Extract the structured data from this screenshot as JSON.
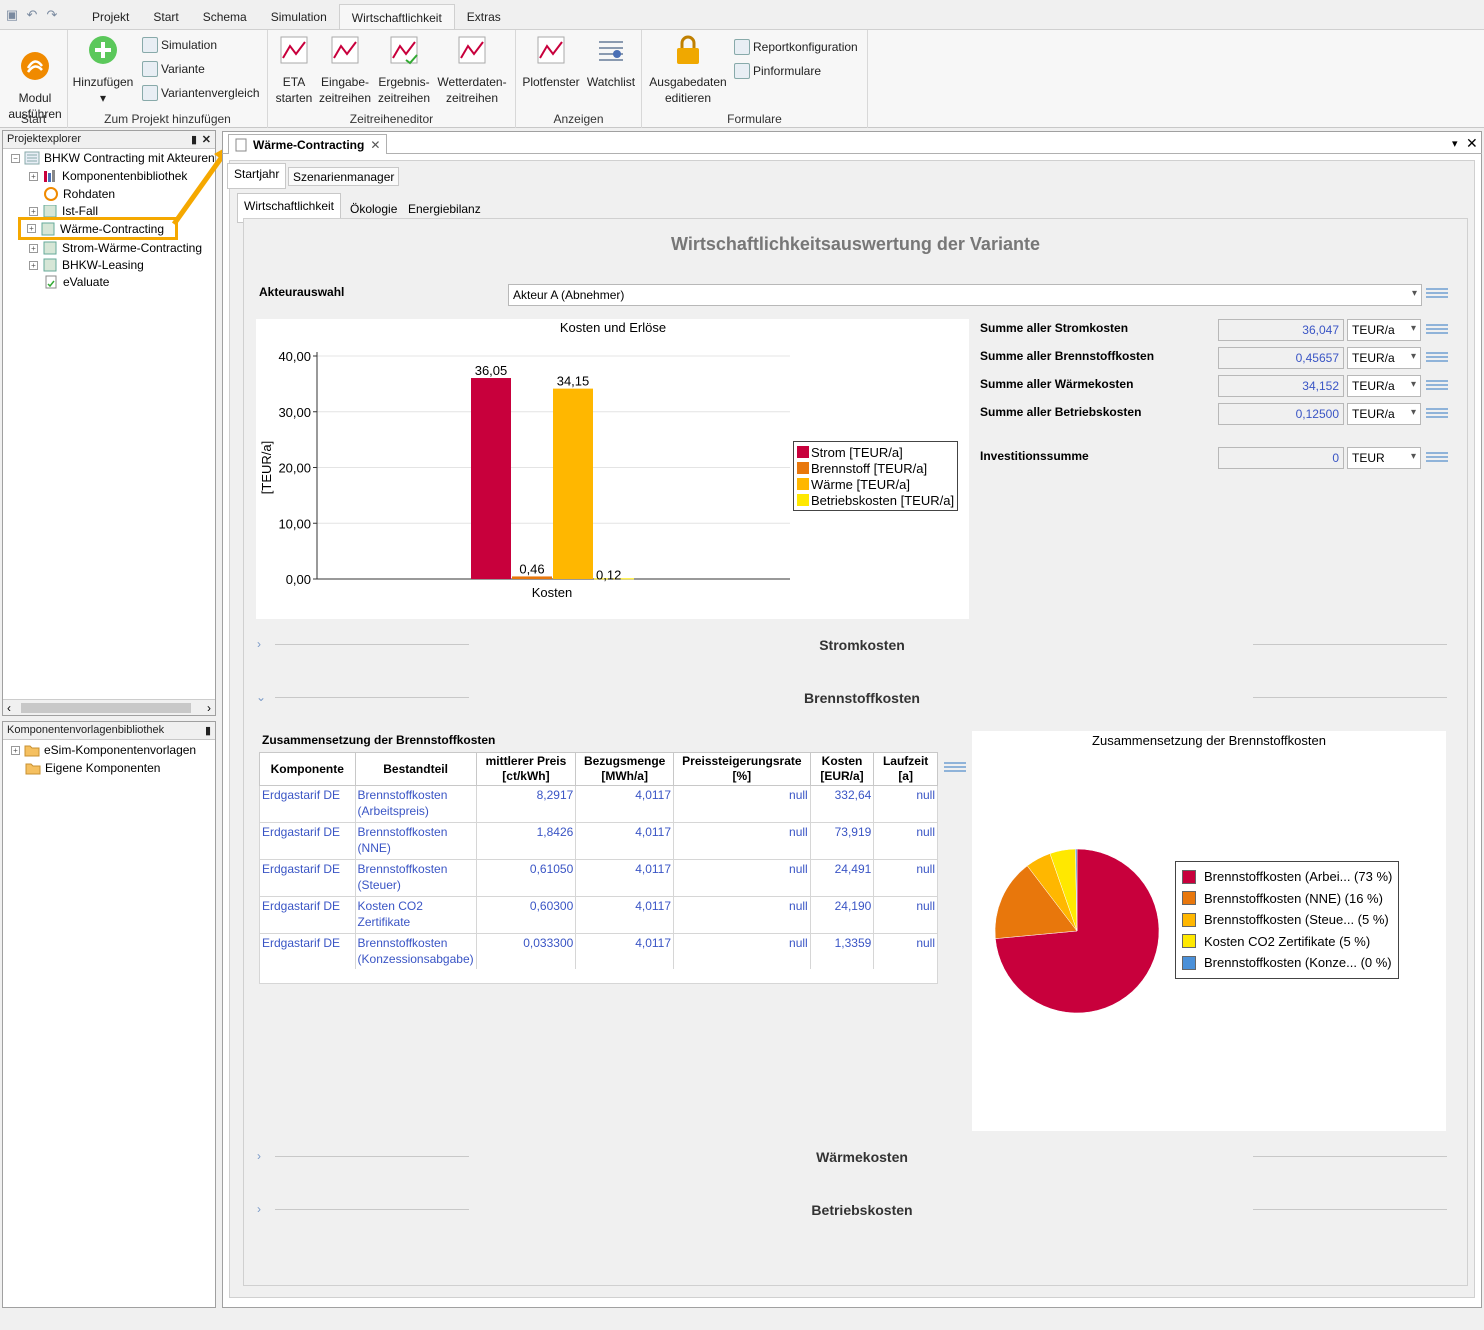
{
  "ribbon": {
    "tabs": [
      "Projekt",
      "Start",
      "Schema",
      "Simulation",
      "Wirtschaftlichkeit",
      "Extras"
    ],
    "groups": {
      "start": {
        "label": "Start",
        "modul": "Modul\nausführen"
      },
      "projekt": {
        "label": "Zum Projekt hinzufügen",
        "add": "Hinzufügen",
        "simulation": "Simulation",
        "variante": "Variante",
        "variantenvergleich": "Variantenvergleich"
      },
      "zeitreihen": {
        "label": "Zeitreiheneditor",
        "eta": "ETA\nstarten",
        "eingabe": "Eingabe-\nzeitreihen",
        "ergebnis": "Ergebnis-\nzeitreihen",
        "wetter": "Wetterdaten-\nzeitreihen"
      },
      "anzeigen": {
        "label": "Anzeigen",
        "plot": "Plotfenster",
        "watch": "Watchlist"
      },
      "formulare": {
        "label": "Formulare",
        "ausgabe": "Ausgabedaten\neditieren",
        "report": "Reportkonfiguration",
        "pin": "Pinformulare"
      }
    }
  },
  "explorer": {
    "title": "Projektexplorer",
    "root": "BHKW Contracting mit Akteuren",
    "items": [
      "Komponentenbibliothek",
      "Rohdaten",
      "Ist-Fall",
      "Wärme-Contracting",
      "Strom-Wärme-Contracting",
      "BHKW-Leasing",
      "eValuate"
    ]
  },
  "library": {
    "title": "Komponentenvorlagenbibliothek",
    "items": [
      "eSim-Komponentenvorlagen",
      "Eigene Komponenten"
    ]
  },
  "document": {
    "tab": "Wärme-Contracting",
    "subtabs": [
      "Startjahr",
      "Szenarienmanager"
    ],
    "innertabs": [
      "Wirtschaftlichkeit",
      "Ökologie",
      "Energiebilanz"
    ],
    "heading": "Wirtschaftlichkeitsauswertung der Variante",
    "akteur_label": "Akteurauswahl",
    "akteur_value": "Akteur A (Abnehmer)",
    "sums": [
      {
        "label": "Summe aller Stromkosten",
        "value": "36,047",
        "unit": "TEUR/a"
      },
      {
        "label": "Summe aller Brennstoffkosten",
        "value": "0,45657",
        "unit": "TEUR/a"
      },
      {
        "label": "Summe aller Wärmekosten",
        "value": "34,152",
        "unit": "TEUR/a"
      },
      {
        "label": "Summe aller Betriebskosten",
        "value": "0,12500",
        "unit": "TEUR/a"
      }
    ],
    "invest": {
      "label": "Investitionssumme",
      "value": "0",
      "unit": "TEUR"
    },
    "sections": {
      "strom": "Stromkosten",
      "brenn": "Brennstoffkosten",
      "waerme": "Wärmekosten",
      "betrieb": "Betriebskosten"
    },
    "table": {
      "title": "Zusammensetzung der Brennstoffkosten",
      "headers": [
        "Komponente",
        "Bestandteil",
        "mittlerer Preis\n[ct/kWh]",
        "Bezugsmenge\n[MWh/a]",
        "Preissteigerungsrate\n[%]",
        "Kosten\n[EUR/a]",
        "Laufzeit\n[a]"
      ],
      "rows": [
        [
          "Erdgastarif DE",
          "Brennstoffkosten (Arbeitspreis)",
          "8,2917",
          "4,0117",
          "null",
          "332,64",
          "null"
        ],
        [
          "Erdgastarif DE",
          "Brennstoffkosten (NNE)",
          "1,8426",
          "4,0117",
          "null",
          "73,919",
          "null"
        ],
        [
          "Erdgastarif DE",
          "Brennstoffkosten (Steuer)",
          "0,61050",
          "4,0117",
          "null",
          "24,491",
          "null"
        ],
        [
          "Erdgastarif DE",
          "Kosten CO2 Zertifikate",
          "0,60300",
          "4,0117",
          "null",
          "24,190",
          "null"
        ],
        [
          "Erdgastarif DE",
          "Brennstoffkosten (Konzessionsabgabe)",
          "0,033300",
          "4,0117",
          "null",
          "1,3359",
          "null"
        ]
      ]
    }
  },
  "chart_data": [
    {
      "type": "bar",
      "title": "Kosten und Erlöse",
      "xlabel": "Kosten",
      "ylabel": "[TEUR/a]",
      "ylim": [
        0,
        40
      ],
      "yticks": [
        "0,00",
        "10,00",
        "20,00",
        "30,00",
        "40,00"
      ],
      "categories": [
        "Kosten"
      ],
      "series": [
        {
          "name": "Strom [TEUR/a]",
          "values": [
            36.05
          ],
          "label": "36,05",
          "color": "#c8003c"
        },
        {
          "name": "Brennstoff [TEUR/a]",
          "values": [
            0.46
          ],
          "label": "0,46",
          "color": "#e8770c"
        },
        {
          "name": "Wärme [TEUR/a]",
          "values": [
            34.15
          ],
          "label": "34,15",
          "color": "#ffb700"
        },
        {
          "name": "Betriebskosten [TEUR/a]",
          "values": [
            0.12
          ],
          "label": "0,12",
          "color": "#ffe800"
        }
      ],
      "legend": "right",
      "grid": true
    },
    {
      "type": "pie",
      "title": "Zusammensetzung der Brennstoffkosten",
      "slices": [
        {
          "name": "Brennstoffkosten (Arbei... (73 %)",
          "value": 73,
          "color": "#c8003c"
        },
        {
          "name": "Brennstoffkosten (NNE) (16 %)",
          "value": 16,
          "color": "#e8770c"
        },
        {
          "name": "Brennstoffkosten (Steue... (5 %)",
          "value": 5,
          "color": "#ffb700"
        },
        {
          "name": "Kosten CO2 Zertifikate (5 %)",
          "value": 5,
          "color": "#ffe800"
        },
        {
          "name": "Brennstoffkosten (Konze... (0 %)",
          "value": 0.3,
          "color": "#4a90d9"
        }
      ],
      "legend": "right"
    }
  ]
}
